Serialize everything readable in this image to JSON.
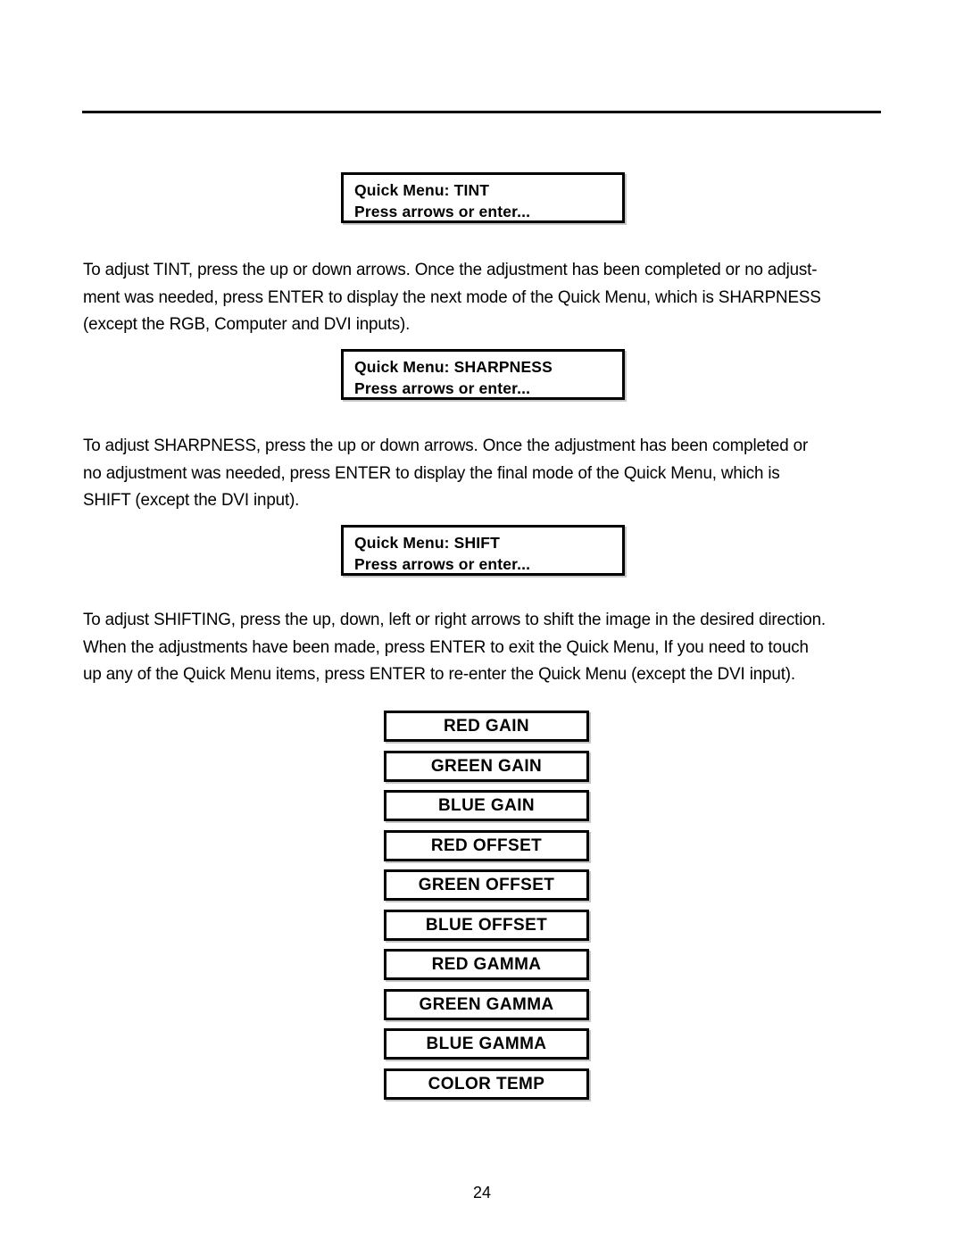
{
  "document": {
    "page_number": "24"
  },
  "osd_boxes": [
    {
      "id": "tint",
      "title": "Quick Menu: TINT",
      "prompt": "Press arrows or enter..."
    },
    {
      "id": "sharpness",
      "title": "Quick Menu: SHARPNESS",
      "prompt": "Press arrows or enter..."
    },
    {
      "id": "shift",
      "title": "Quick Menu: SHIFT",
      "prompt": "Press arrows or enter..."
    }
  ],
  "paragraphs": {
    "tint": "To adjust TINT, press the up or down arrows. Once the adjustment has been completed or no adjust-\nment was needed, press ENTER to display the next mode of the Quick Menu, which is SHARPNESS\n(except the RGB, Computer and DVI inputs).",
    "sharpness": "To adjust SHARPNESS, press the up or down arrows. Once the adjustment has been completed or\nno adjustment was needed, press ENTER to display the final mode of the Quick Menu, which is\nSHIFT (except the DVI input).",
    "shift": "To adjust SHIFTING, press the up, down, left or right arrows to shift the image in the desired direction.\nWhen the adjustments have been made, press ENTER to exit the Quick Menu, If you need to touch\nup any of the Quick Menu items, press ENTER to re-enter the Quick Menu (except the DVI input)."
  },
  "menu_stack": {
    "items": [
      {
        "label": "RED GAIN"
      },
      {
        "label": "GREEN GAIN"
      },
      {
        "label": "BLUE GAIN"
      },
      {
        "label": "RED OFFSET"
      },
      {
        "label": "GREEN OFFSET"
      },
      {
        "label": "BLUE OFFSET"
      },
      {
        "label": "RED GAMMA"
      },
      {
        "label": "GREEN GAMMA"
      },
      {
        "label": "BLUE GAMMA"
      },
      {
        "label": "COLOR TEMP"
      }
    ]
  },
  "colors": {
    "ink": "#000000",
    "paper": "#ffffff"
  }
}
